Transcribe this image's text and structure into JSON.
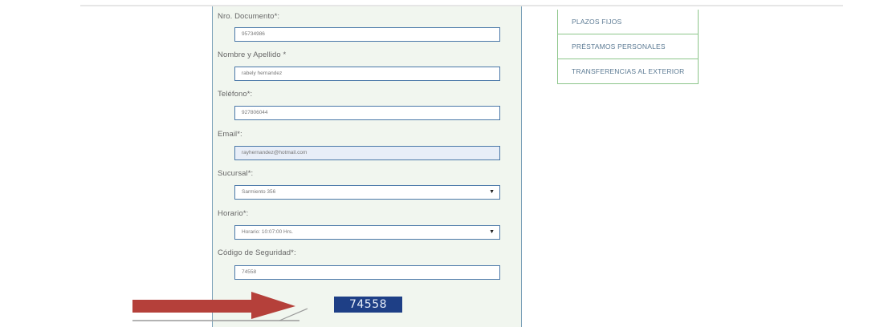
{
  "form": {
    "documento": {
      "label": "Nro. Documento*:",
      "value": "95734986"
    },
    "nombre": {
      "label": "Nombre y Apellido *",
      "value": "rabely hernandez"
    },
    "telefono": {
      "label": "Teléfono*:",
      "value": "927806044"
    },
    "email": {
      "label": "Email*:",
      "value": "rayhernandez@hotmail.com"
    },
    "sucursal": {
      "label": "Sucursal*:",
      "value": "Sarmiento 356"
    },
    "horario": {
      "label": "Horario*:",
      "value": "Horario: 10:07:00 Hrs."
    },
    "codigo": {
      "label": "Código de Seguridad*:",
      "value": "74558"
    },
    "captcha_text": "74558"
  },
  "side_menu": {
    "items": [
      {
        "label": "PLAZOS FIJOS"
      },
      {
        "label": "PRÉSTAMOS PERSONALES"
      },
      {
        "label": "TRANSFERENCIAS AL EXTERIOR"
      }
    ]
  },
  "colors": {
    "panel_bg": "#f1f6ef",
    "field_border": "#4a78a8",
    "captcha_bg": "#1e3f86",
    "menu_border": "#8cc58a",
    "menu_text": "#5b7a93",
    "arrow": "#b5403a"
  },
  "icons": {
    "select_arrow": "dropdown-arrow-icon",
    "annotation": "pointing-arrow-icon"
  }
}
